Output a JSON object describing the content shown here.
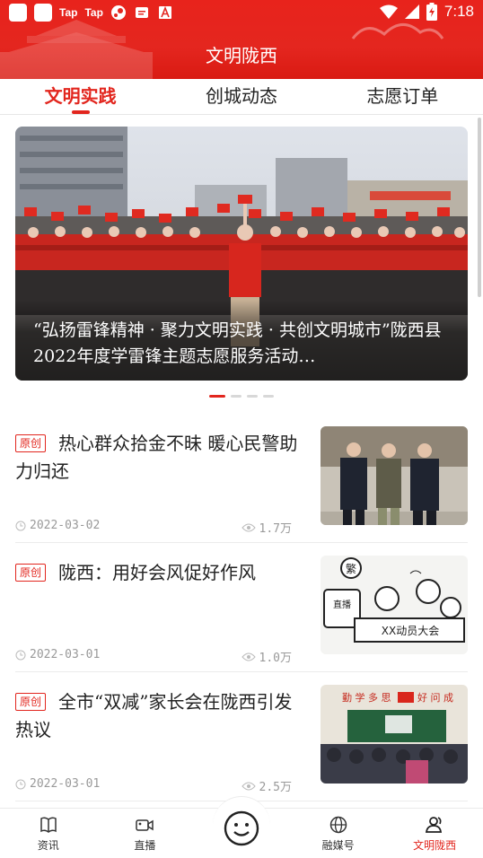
{
  "status_bar": {
    "icons": [
      "app-icon",
      "app-icon",
      "taptap-icon",
      "taptap-icon",
      "steam-icon",
      "message-icon",
      "a-icon"
    ],
    "taptap_1": "Tap",
    "taptap_2": "Tap",
    "time": "7:18",
    "battery_icon": "battery-charging-icon",
    "signal_icon": "signal-icon",
    "wifi_icon": "wifi-icon"
  },
  "header": {
    "title": "文明陇西",
    "bg_color": "#e4261f"
  },
  "tabs": [
    {
      "label": "文明实践",
      "active": true
    },
    {
      "label": "创城动态",
      "active": false
    },
    {
      "label": "志愿订单",
      "active": false
    }
  ],
  "banner": {
    "caption": "“弘扬雷锋精神 · 聚力文明实践 · 共创文明城市”陇西县2022年度学雷锋主题志愿服务活动…",
    "page_count": 4,
    "active_page": 0
  },
  "news": [
    {
      "badge": "原创",
      "title": "热心群众拾金不昧  暖心民警助力归还",
      "date": "2022-03-02",
      "views": "1.7万",
      "thumb": "police-photo"
    },
    {
      "badge": "原创",
      "title": "陇西：用好会风促好作风",
      "date": "2022-03-01",
      "views": "1.0万",
      "thumb": "cartoon-meeting",
      "thumb_text": {
        "sign": "XX动员大会",
        "camera": "直播",
        "stamp": "繁"
      }
    },
    {
      "badge": "原创",
      "title": "全市“双减”家长会在陇西引发热议",
      "date": "2022-03-01",
      "views": "2.5万",
      "thumb": "classroom-photo",
      "thumb_text": {
        "slogan_left": "勤 学 多 思",
        "slogan_right": "好 问 成"
      }
    }
  ],
  "bottom_nav": [
    {
      "label": "资讯",
      "icon": "book-icon",
      "active": false
    },
    {
      "label": "直播",
      "icon": "video-camera-icon",
      "active": false
    },
    {
      "label": "",
      "icon": "smiley-icon",
      "active": false
    },
    {
      "label": "融媒号",
      "icon": "globe-icon",
      "active": false
    },
    {
      "label": "文明陇西",
      "icon": "users-icon",
      "active": true
    }
  ],
  "accent_color": "#e2261e"
}
